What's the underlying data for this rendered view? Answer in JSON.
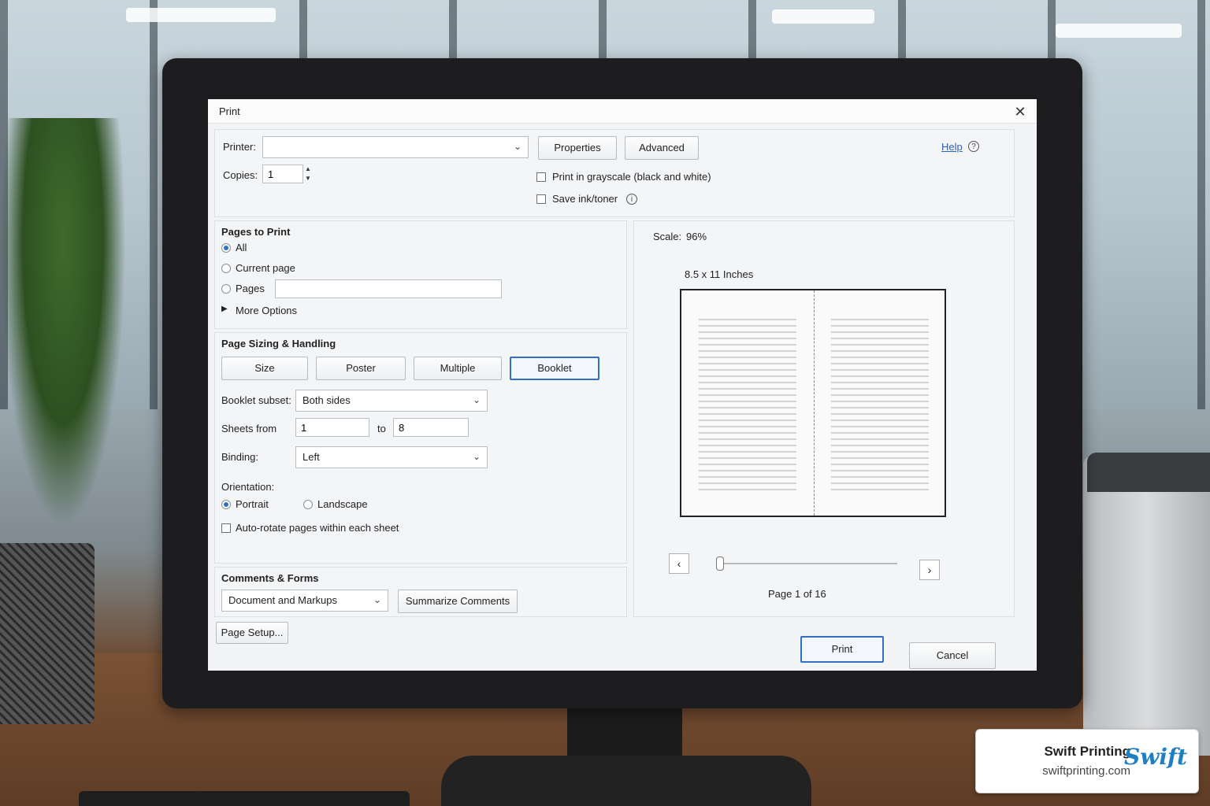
{
  "dialog": {
    "title": "Print",
    "printer_label": "Printer:",
    "printer_value": "",
    "properties_label": "Properties",
    "advanced_label": "Advanced",
    "help_label": "Help",
    "copies_label": "Copies:",
    "copies_value": "1",
    "grayscale_label": "Print in grayscale (black and white)",
    "grayscale_checked": false,
    "save_ink_label": "Save ink/toner",
    "save_ink_checked": false
  },
  "pages_to_print": {
    "title": "Pages to Print",
    "options": [
      "All",
      "Current page",
      "Pages"
    ],
    "selected": "All",
    "pages_value": "",
    "more_options_label": "More Options"
  },
  "sizing": {
    "title": "Page Sizing & Handling",
    "modes": [
      "Size",
      "Poster",
      "Multiple",
      "Booklet"
    ],
    "selected_mode": "Booklet",
    "booklet_subset_label": "Booklet subset:",
    "booklet_subset_value": "Both sides",
    "sheets_from_label": "Sheets from",
    "sheets_from_value": "1",
    "sheets_to_label": "to",
    "sheets_to_value": "8",
    "binding_label": "Binding:",
    "binding_value": "Left",
    "orientation_label": "Orientation:",
    "orientation_options": [
      "Portrait",
      "Landscape"
    ],
    "orientation_selected": "Portrait",
    "autorotate_label": "Auto-rotate pages within each sheet",
    "autorotate_checked": false
  },
  "comments": {
    "title": "Comments & Forms",
    "value": "Document and Markups",
    "summarize_label": "Summarize Comments"
  },
  "page_setup_label": "Page Setup...",
  "preview": {
    "scale_label": "Scale:",
    "scale_value": "96%",
    "paper_size": "8.5 x 11 Inches",
    "page_indicator": "Page 1 of 16",
    "prev_icon": "chevron-left-icon",
    "next_icon": "chevron-right-icon",
    "current_page": 1,
    "total_pages": 16
  },
  "actions": {
    "print_label": "Print",
    "cancel_label": "Cancel"
  },
  "brand": {
    "name": "Swift Printing",
    "url": "swiftprinting.com",
    "logo_text": "Swift"
  },
  "colors": {
    "accent": "#2f6fc6",
    "link": "#2f5fc0",
    "brand": "#1f7fc4"
  }
}
